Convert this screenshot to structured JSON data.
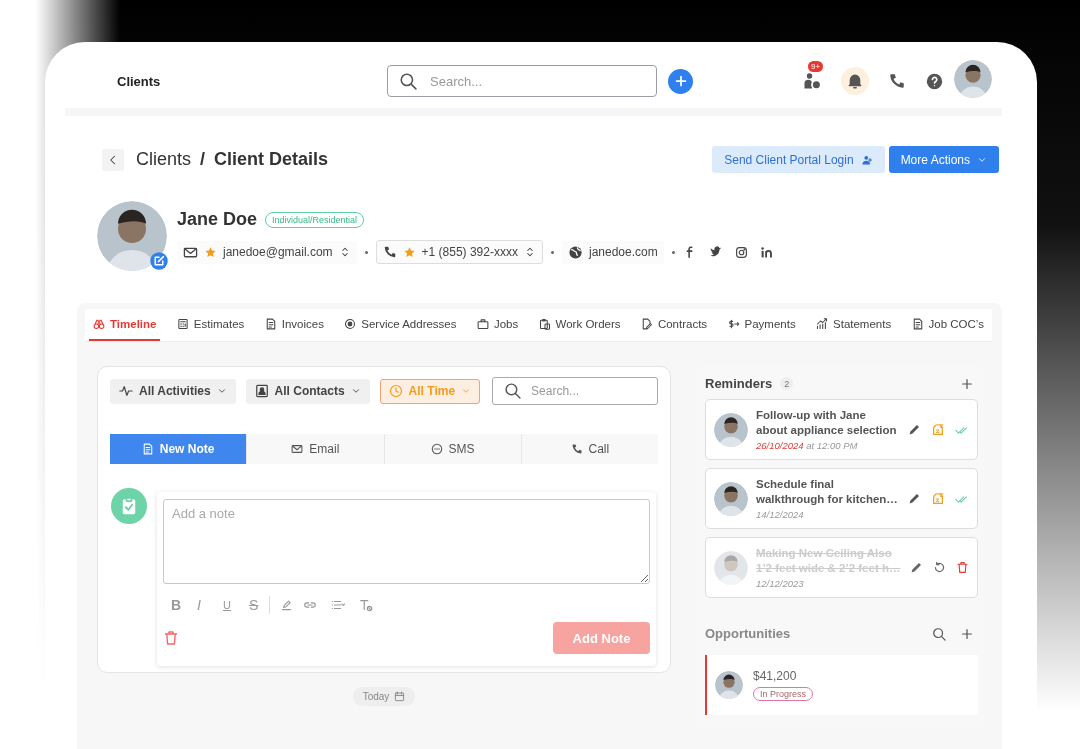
{
  "topbar": {
    "title": "Clients",
    "search": {
      "placeholder": "Search..."
    },
    "notification_badge": "9+"
  },
  "breadcrumb": {
    "items": [
      "Clients",
      "Client Details"
    ],
    "separator": "/"
  },
  "actions": [
    {
      "label": "Send Client Portal Login",
      "kind": "secondary"
    },
    {
      "label": "More Actions",
      "kind": "primary"
    }
  ],
  "client": {
    "name": "Jane Doe",
    "type": "Individual/Residential",
    "email": "janedoe@gmail.com",
    "phone": "+1 (855) 392-xxxx",
    "website": "janedoe.com"
  },
  "tabs": [
    {
      "label": "Timeline",
      "selected": true
    },
    {
      "label": "Estimates",
      "selected": false
    },
    {
      "label": "Invoices",
      "selected": false
    },
    {
      "label": "Service Addresses",
      "selected": false
    },
    {
      "label": "Jobs",
      "selected": false
    },
    {
      "label": "Work Orders",
      "selected": false
    },
    {
      "label": "Contracts",
      "selected": false
    },
    {
      "label": "Payments",
      "selected": false
    },
    {
      "label": "Statements",
      "selected": false
    },
    {
      "label": "Job COC’s",
      "selected": false
    }
  ],
  "filters": [
    {
      "label": "All Activities",
      "highlighted": false
    },
    {
      "label": "All Contacts",
      "highlighted": false
    },
    {
      "label": "All Time",
      "highlighted": true
    }
  ],
  "timeline_search": {
    "placeholder": "Search..."
  },
  "compose_tabs": [
    {
      "label": "New Note",
      "selected": true
    },
    {
      "label": "Email",
      "selected": false
    },
    {
      "label": "SMS",
      "selected": false
    },
    {
      "label": "Call",
      "selected": false
    }
  ],
  "note": {
    "placeholder": "Add a note",
    "format_buttons": [
      "B",
      "I",
      "U",
      "S"
    ],
    "button": "Add Note"
  },
  "date_chip": "Today",
  "reminders": {
    "title": "Reminders",
    "count": "2",
    "items": [
      {
        "title": "Follow-up with Jane about appliance selection",
        "date": "26/10/2024",
        "time": "at 12:00 PM",
        "overdue": true,
        "completed": false
      },
      {
        "title": "Schedule final walkthrough for kitchen…",
        "date": "14/12/2024",
        "overdue": false,
        "completed": false
      },
      {
        "title": "Making New Ceiling Also 1’2 feet wide & 2’2 feet h…",
        "date": "12/12/2023",
        "overdue": false,
        "completed": true
      }
    ]
  },
  "opportunities": {
    "title": "Opportunities",
    "items": [
      {
        "amount": "$41,200",
        "status": "In Progress"
      }
    ]
  }
}
